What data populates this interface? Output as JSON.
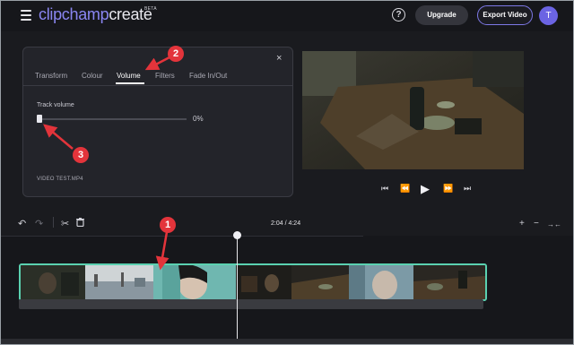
{
  "header": {
    "logo_part1": "clipchamp",
    "logo_part2": "create",
    "beta": "BETA",
    "help_glyph": "?",
    "upgrade_label": "Upgrade",
    "export_label": "Export Video",
    "avatar_initial": "T"
  },
  "panel": {
    "close_glyph": "×",
    "tabs": [
      {
        "label": "Transform"
      },
      {
        "label": "Colour"
      },
      {
        "label": "Volume"
      },
      {
        "label": "Filters"
      },
      {
        "label": "Fade In/Out"
      }
    ],
    "active_tab": "Volume",
    "track_volume_label": "Track volume",
    "track_volume_value": "0%",
    "track_volume_level": 0,
    "file_name": "VIDEO TEST.MP4"
  },
  "player": {
    "controls": [
      "skip-back",
      "rewind",
      "play",
      "fast-forward",
      "skip-forward"
    ]
  },
  "timeline": {
    "timecode": "2:04 / 4:24",
    "tools": [
      "undo",
      "redo",
      "split",
      "delete"
    ],
    "zoom_in": "+",
    "zoom_out": "−",
    "fit": "→←"
  },
  "annotations": [
    {
      "number": "1"
    },
    {
      "number": "2"
    },
    {
      "number": "3"
    }
  ],
  "colors": {
    "accent": "#7d78e6",
    "clip_border": "#5ad1b0",
    "annotation": "#e3343b"
  }
}
